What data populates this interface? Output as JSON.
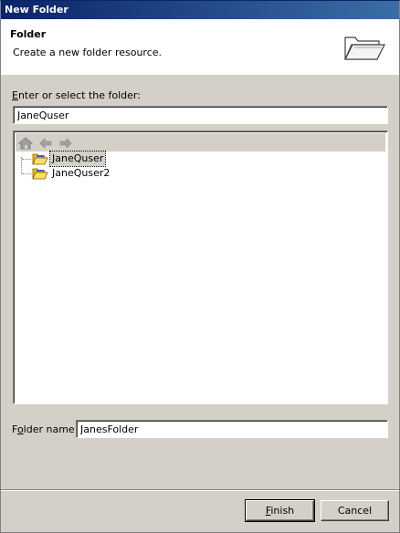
{
  "window": {
    "title": "New Folder"
  },
  "header": {
    "title": "Folder",
    "description": "Create a new folder resource."
  },
  "container": {
    "label_mnemonic": "E",
    "label_rest": "nter or select the folder:",
    "value": "JaneQuser"
  },
  "tree": {
    "items": [
      {
        "label": "JaneQuser",
        "selected": true
      },
      {
        "label": "JaneQuser2",
        "selected": false
      }
    ]
  },
  "folder_name": {
    "label_pre": "F",
    "label_mnemonic": "o",
    "label_rest": "lder name:",
    "value": "JanesFolder"
  },
  "buttons": {
    "finish_mnemonic": "F",
    "finish_rest": "inish",
    "cancel": "Cancel"
  },
  "colors": {
    "titlebar": "#0a246a",
    "face": "#d4d0c8",
    "folder": "#f0c000"
  }
}
